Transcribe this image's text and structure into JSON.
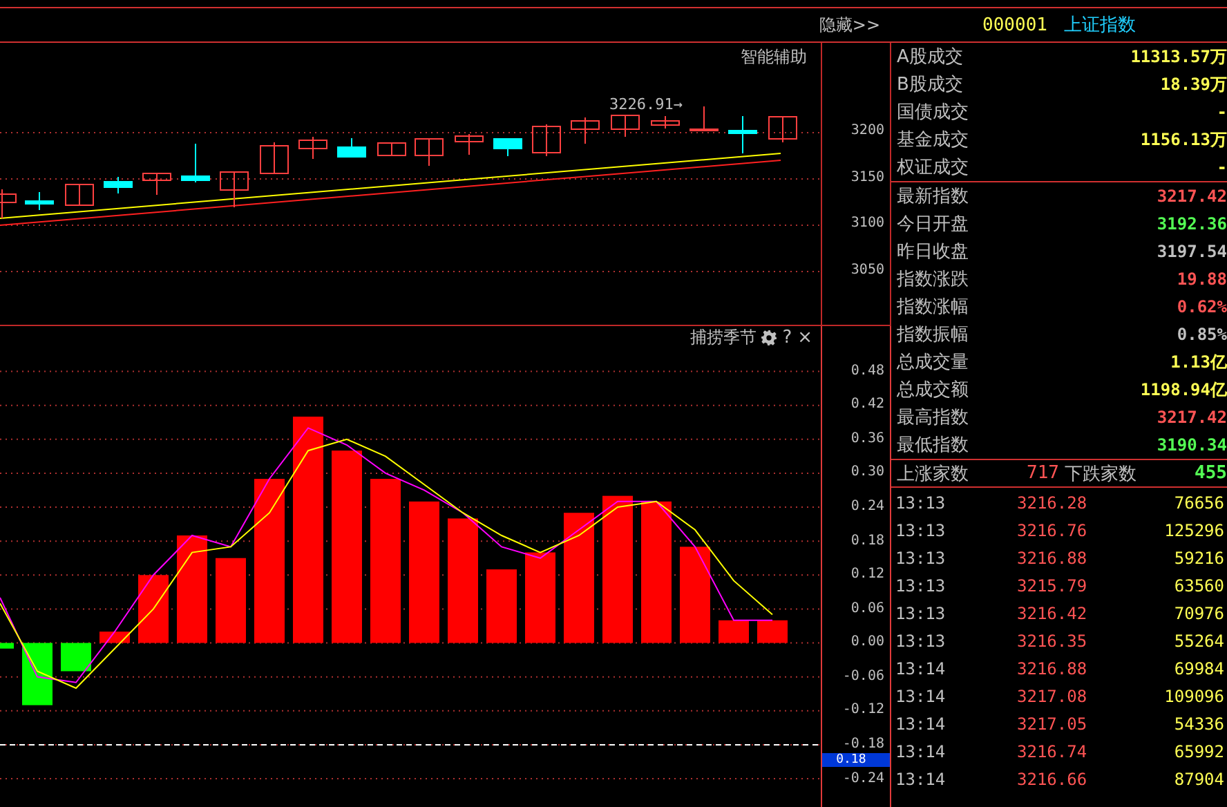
{
  "toolbar": {
    "hide_button": "隐藏>>"
  },
  "price_chart": {
    "title": "智能辅助",
    "high_marker": "3226.91→",
    "axis_labels": [
      "3200",
      "3150",
      "3100",
      "3050"
    ]
  },
  "indicator": {
    "title": "捕捞季节",
    "help": "?",
    "close": "×",
    "crosshair_value": "0.18",
    "chart_data": {
      "type": "bar",
      "grid": true,
      "ylim": [
        -0.29,
        0.56
      ],
      "ref_lines": [
        {
          "axis": "y",
          "value": -0.18
        }
      ],
      "yticks": [
        {
          "value": 0.48,
          "label": "0.48"
        },
        {
          "value": 0.42,
          "label": "0.42"
        },
        {
          "value": 0.36,
          "label": "0.36"
        },
        {
          "value": 0.3,
          "label": "0.30"
        },
        {
          "value": 0.24,
          "label": "0.24"
        },
        {
          "value": 0.18,
          "label": "0.18"
        },
        {
          "value": 0.12,
          "label": "0.12"
        },
        {
          "value": 0.06,
          "label": "0.06"
        },
        {
          "value": 0,
          "label": "0.00"
        },
        {
          "value": -0.06,
          "label": "-0.06"
        },
        {
          "value": -0.12,
          "label": "-0.12"
        },
        {
          "value": -0.18,
          "label": "-0.18"
        },
        {
          "value": -0.24,
          "label": "-0.24"
        }
      ],
      "series": [
        {
          "color": "#ff0000",
          "values": [
            null,
            null,
            null,
            0.02,
            0.12,
            0.19,
            0.15,
            0.29,
            0.4,
            0.34,
            0.29,
            0.25,
            0.22,
            0.13,
            0.16,
            0.23,
            0.26,
            0.25,
            0.17,
            0.04,
            0.04
          ]
        },
        {
          "color": "#00ff00",
          "values": [
            -0.01,
            -0.11,
            -0.05,
            null,
            null,
            null,
            null,
            null,
            null,
            null,
            null,
            null,
            null,
            null,
            null,
            null,
            null,
            null,
            null,
            null,
            null
          ]
        },
        {
          "type": "line",
          "color": "#ff00ff",
          "values": [
            0.08,
            -0.06,
            -0.07,
            0.02,
            0.12,
            0.19,
            0.17,
            0.29,
            0.38,
            0.35,
            0.3,
            0.27,
            0.23,
            0.17,
            0.15,
            0.2,
            0.25,
            0.25,
            0.17,
            0.04,
            0.04
          ]
        },
        {
          "type": "line",
          "color": "#ffff00",
          "values": [
            0.07,
            -0.05,
            -0.08,
            -0.01,
            0.06,
            0.16,
            0.17,
            0.23,
            0.34,
            0.36,
            0.33,
            0.28,
            0.23,
            0.19,
            0.16,
            0.19,
            0.24,
            0.25,
            0.2,
            0.11,
            0.05
          ]
        }
      ]
    }
  },
  "quote": {
    "code": "000001",
    "name": "上证指数",
    "volume_rows": [
      {
        "label": "A股成交",
        "value": "11313.57万",
        "color": "#ffff54"
      },
      {
        "label": "B股成交",
        "value": "18.39万",
        "color": "#ffff54"
      },
      {
        "label": "国债成交",
        "value": "-",
        "color": "#ffff54"
      },
      {
        "label": "基金成交",
        "value": "1156.13万",
        "color": "#ffff54"
      },
      {
        "label": "权证成交",
        "value": "-",
        "color": "#ffff54"
      }
    ],
    "index_rows": [
      {
        "label": "最新指数",
        "value": "3217.42",
        "color": "#ff5454"
      },
      {
        "label": "今日开盘",
        "value": "3192.36",
        "color": "#54ff54"
      },
      {
        "label": "昨日收盘",
        "value": "3197.54",
        "color": "#c0c0c0"
      },
      {
        "label": "指数涨跌",
        "value": "19.88",
        "color": "#ff5454"
      },
      {
        "label": "指数涨幅",
        "value": "0.62%",
        "color": "#ff5454"
      },
      {
        "label": "指数振幅",
        "value": "0.85%",
        "color": "#c0c0c0"
      },
      {
        "label": "总成交量",
        "value": "1.13亿",
        "color": "#ffff54"
      },
      {
        "label": "总成交额",
        "value": "1198.94亿",
        "color": "#ffff54"
      },
      {
        "label": "最高指数",
        "value": "3217.42",
        "color": "#ff5454"
      },
      {
        "label": "最低指数",
        "value": "3190.34",
        "color": "#54ff54"
      }
    ],
    "breadth": {
      "up_label": "上涨家数",
      "up_count": "717",
      "down_label": "下跌家数",
      "down_count": "455"
    },
    "ticks": [
      {
        "time": "13:13",
        "price": "3216.28",
        "volume": "76656"
      },
      {
        "time": "13:13",
        "price": "3216.76",
        "volume": "125296"
      },
      {
        "time": "13:13",
        "price": "3216.88",
        "volume": "59216"
      },
      {
        "time": "13:13",
        "price": "3215.79",
        "volume": "63560"
      },
      {
        "time": "13:13",
        "price": "3216.42",
        "volume": "70976"
      },
      {
        "time": "13:13",
        "price": "3216.35",
        "volume": "55264"
      },
      {
        "time": "13:14",
        "price": "3216.88",
        "volume": "69984"
      },
      {
        "time": "13:14",
        "price": "3217.08",
        "volume": "109096"
      },
      {
        "time": "13:14",
        "price": "3217.05",
        "volume": "54336"
      },
      {
        "time": "13:14",
        "price": "3216.74",
        "volume": "65992"
      },
      {
        "time": "13:14",
        "price": "3216.66",
        "volume": "87904"
      }
    ]
  }
}
